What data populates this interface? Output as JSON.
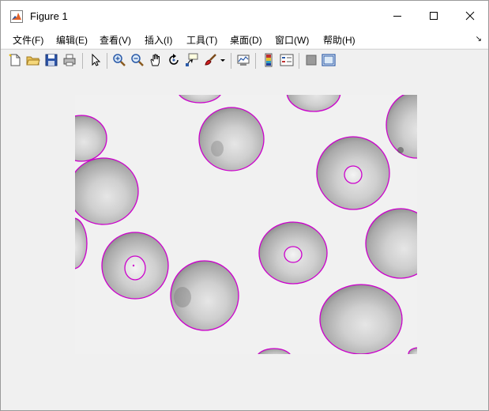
{
  "window": {
    "title": "Figure 1",
    "icons": {
      "app": "matlab-logo-icon",
      "minimize": "minimize-icon",
      "maximize": "maximize-icon",
      "close": "close-icon"
    }
  },
  "menubar": {
    "items": [
      {
        "label": "文件(F)"
      },
      {
        "label": "编辑(E)"
      },
      {
        "label": "查看(V)"
      },
      {
        "label": "插入(I)"
      },
      {
        "label": "工具(T)"
      },
      {
        "label": "桌面(D)"
      },
      {
        "label": "窗口(W)"
      },
      {
        "label": "帮助(H)"
      }
    ],
    "dock_arrow": "↘"
  },
  "toolbar": {
    "tools": [
      "new-figure-icon",
      "open-icon",
      "save-icon",
      "print-icon",
      "pointer-icon",
      "zoom-in-icon",
      "zoom-out-icon",
      "pan-hand-icon",
      "rotate-3d-icon",
      "data-cursor-icon",
      "brush-icon",
      "brush-dropdown-icon",
      "link-plot-icon",
      "colorbar-icon",
      "legend-icon",
      "hide-plot-tools-icon",
      "show-plot-tools-icon"
    ]
  },
  "figure": {
    "image": "blood-cell-segmentation",
    "outline_color": "#cc00cc"
  }
}
